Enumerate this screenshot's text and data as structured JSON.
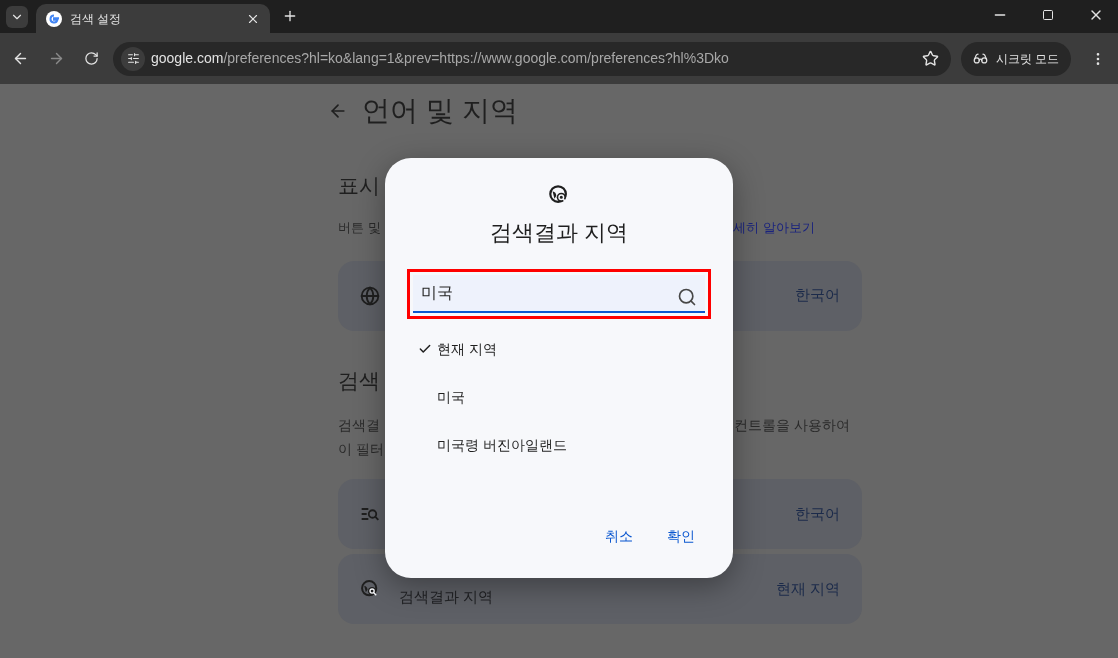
{
  "browser": {
    "tab": {
      "title": "검색 설정"
    },
    "address": {
      "host": "google.com",
      "path": "/preferences?hl=ko&lang=1&prev=https://www.google.com/preferences?hl%3Dko"
    },
    "incognito": "시크릿 모드"
  },
  "page": {
    "title": "언어 및 지역",
    "display_section": {
      "heading": "표시",
      "text": "버튼 및",
      "link": "세히 알아보기",
      "rows": [
        {
          "kind": "globe",
          "value": "한국어"
        }
      ]
    },
    "results_section": {
      "heading": "검색",
      "lines": [
        {
          "left": "검색결",
          "right": "컨트롤을 사용하여"
        },
        {
          "left": "이 필터"
        }
      ],
      "rows": [
        {
          "kind": "filter",
          "value": "한국어"
        },
        {
          "kind": "region",
          "label": "검색결과 지역",
          "value": "현재 지역"
        }
      ]
    }
  },
  "dialog": {
    "title": "검색결과 지역",
    "search": {
      "value": "미국",
      "highlighted": true
    },
    "options": [
      {
        "label": "현재 지역",
        "selected": true
      },
      {
        "label": "미국",
        "selected": false
      },
      {
        "label": "미국령 버진아일랜드",
        "selected": false
      }
    ],
    "buttons": [
      "취소",
      "확인"
    ]
  }
}
